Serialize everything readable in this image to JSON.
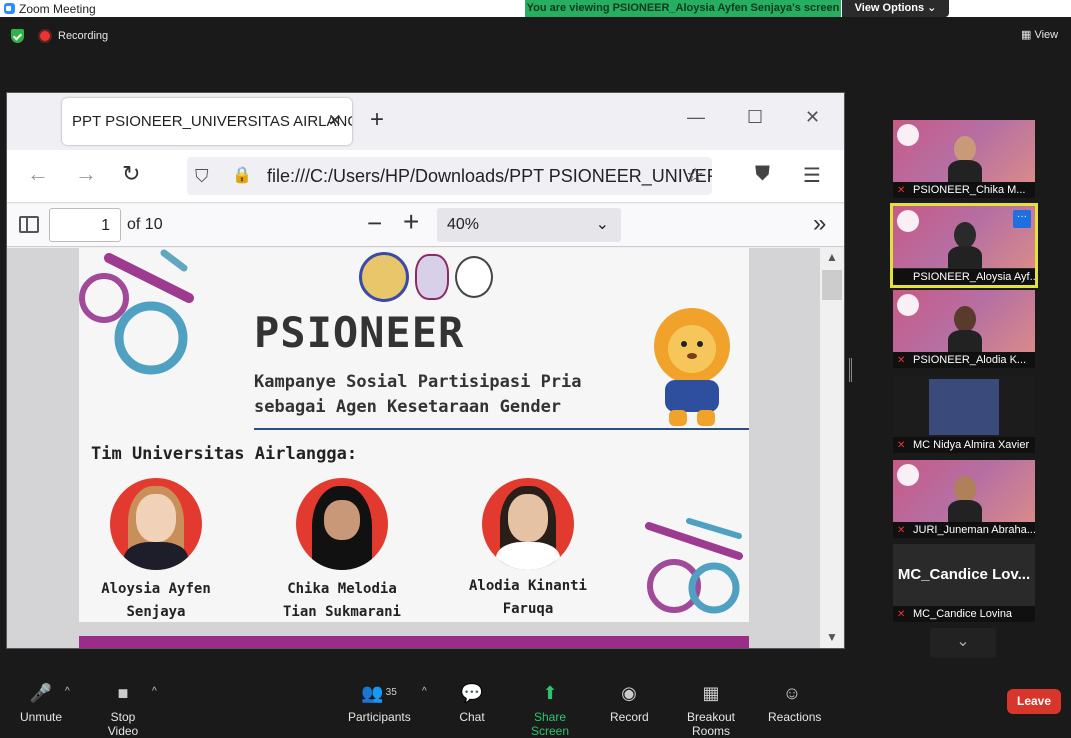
{
  "window": {
    "title": "Zoom Meeting"
  },
  "banner": {
    "viewing": "You are viewing PSIONEER_Aloysia Ayfen Senjaya's screen",
    "view_options": "View Options ⌄"
  },
  "status": {
    "recording": "Recording",
    "view": "View"
  },
  "browser": {
    "tab_title": "PPT PSIONEER_UNIVERSITAS AIRLANGGA",
    "url": "file:///C:/Users/HP/Downloads/PPT PSIONEER_UNIVERSITAS AIRLANGGA.pdf"
  },
  "pdf": {
    "page": "1",
    "of": "of 10",
    "zoom": "40%"
  },
  "slide": {
    "title": "PSIONEER",
    "subtitle_line1": "Kampanye Sosial Partisipasi Pria",
    "subtitle_line2": "sebagai Agen Kesetaraan Gender",
    "team_heading": "Tim Universitas Airlangga:",
    "members": [
      {
        "line1": "Aloysia Ayfen",
        "line2": "Senjaya"
      },
      {
        "line1": "Chika Melodia",
        "line2": "Tian Sukmarani"
      },
      {
        "line1": "Alodia Kinanti",
        "line2": "Faruqa"
      }
    ]
  },
  "participants_panel": [
    {
      "name": "PSIONEER_Chika M..."
    },
    {
      "name": "PSIONEER_Aloysia Ayf..."
    },
    {
      "name": "PSIONEER_Alodia K..."
    },
    {
      "name": "MC Nidya Almira Xavier"
    },
    {
      "name": "JURI_Juneman Abraha..."
    },
    {
      "name": "MC_Candice Lovina",
      "display": "MC_Candice Lov..."
    }
  ],
  "toolbar": {
    "unmute": "Unmute",
    "stop_video": "Stop Video",
    "participants": "Participants",
    "participants_count": "35",
    "chat": "Chat",
    "share_screen": "Share Screen",
    "record": "Record",
    "breakout": "Breakout Rooms",
    "reactions": "Reactions",
    "leave": "Leave"
  }
}
